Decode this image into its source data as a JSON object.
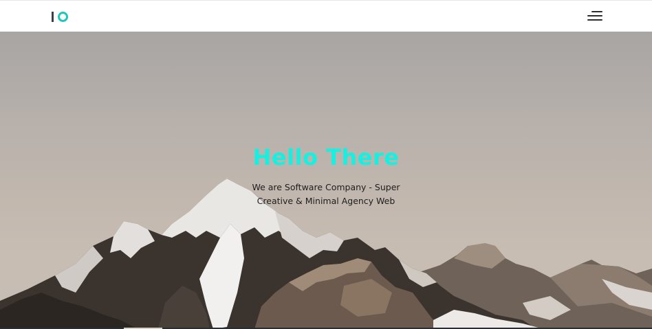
{
  "header": {
    "logo_icon": "io-logo-icon",
    "menu_icon": "hamburger-menu-icon"
  },
  "hero": {
    "title": "Hello There",
    "subtitle_line1": "We are Software Company - Super",
    "subtitle_line2": "Creative & Minimal Agency Web",
    "background_image": "snowy-mountain-peaks-photo"
  },
  "colors": {
    "brand_accent": "#1dc8b8",
    "title": "#17f0e0",
    "text": "#1d1d1d",
    "nav_bg": "#ffffff"
  }
}
